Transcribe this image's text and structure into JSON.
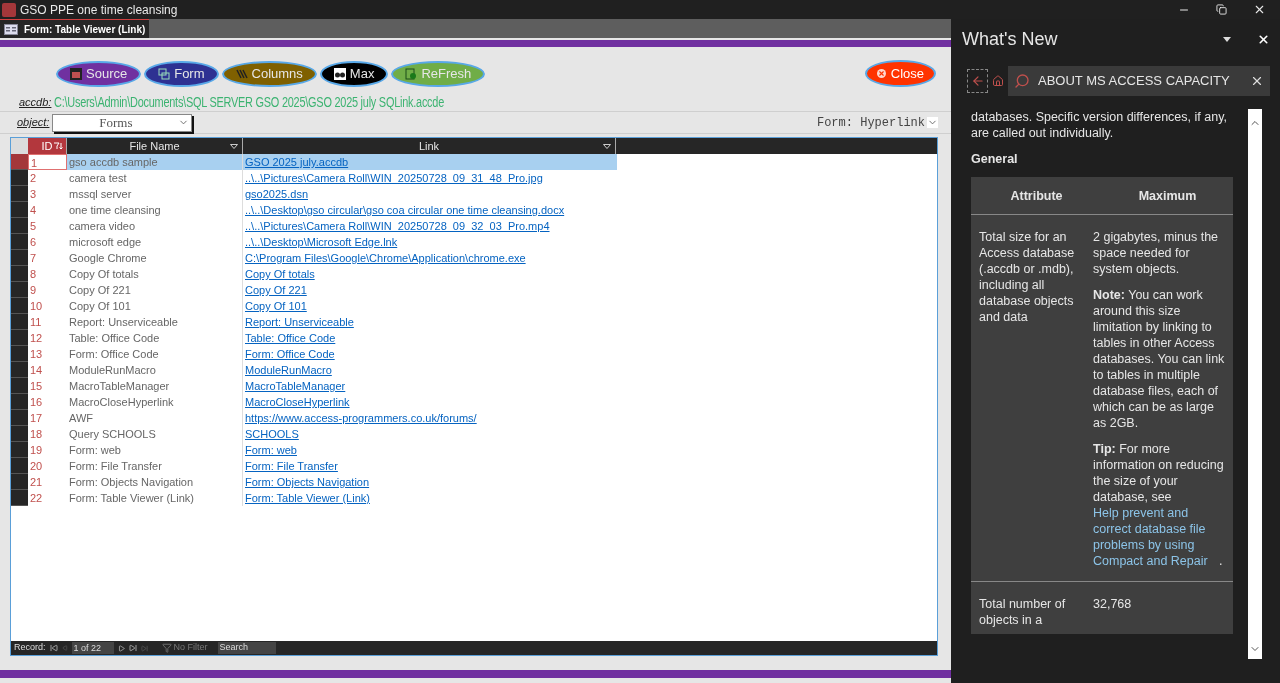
{
  "window": {
    "title": "GSO PPE one time cleansing"
  },
  "document_tabs": [
    {
      "label": "Form: Table Viewer (Link)",
      "selected": true
    }
  ],
  "form": {
    "buttons": [
      {
        "label": "Source",
        "color": "#7030a0"
      },
      {
        "label": "Form",
        "color": "#2e3192"
      },
      {
        "label": "Columns",
        "color": "#7f6000"
      },
      {
        "label": "Max",
        "color": "#000000"
      },
      {
        "label": "ReFresh",
        "color": "#70ad47"
      }
    ],
    "close_button": {
      "label": "Close"
    },
    "accdb": {
      "label": "accdb:",
      "path": "C:\\Users\\Admin\\Documents\\SQL SERVER GSO 2025\\GSO 2025 july SQLink.accde"
    },
    "object": {
      "label": "object:",
      "value": "Forms"
    },
    "form_select": {
      "value": "Form: Hyperlink"
    }
  },
  "datasheet": {
    "columns": [
      {
        "label": "ID",
        "sorted": true
      },
      {
        "label": "File Name",
        "sorted": false
      },
      {
        "label": "Link",
        "sorted": false
      }
    ],
    "rows": [
      {
        "id": "1",
        "name": "gso accdb sample",
        "link": "GSO 2025 july.accdb",
        "selected": true
      },
      {
        "id": "2",
        "name": "camera test",
        "link": "..\\..\\Pictures\\Camera Roll\\WIN_20250728_09_31_48_Pro.jpg",
        "selected": false
      },
      {
        "id": "3",
        "name": "mssql server",
        "link": "gso2025.dsn",
        "selected": false
      },
      {
        "id": "4",
        "name": "one time cleansing",
        "link": "..\\..\\Desktop\\gso circular\\gso coa circular one time cleansing.docx",
        "selected": false
      },
      {
        "id": "5",
        "name": "camera video",
        "link": "..\\..\\Pictures\\Camera Roll\\WIN_20250728_09_32_03_Pro.mp4",
        "selected": false
      },
      {
        "id": "6",
        "name": "microsoft edge",
        "link": "..\\..\\Desktop\\Microsoft Edge.lnk",
        "selected": false
      },
      {
        "id": "7",
        "name": "Google Chrome",
        "link": "C:\\Program Files\\Google\\Chrome\\Application\\chrome.exe",
        "selected": false
      },
      {
        "id": "8",
        "name": "Copy Of totals",
        "link": "Copy Of totals",
        "selected": false
      },
      {
        "id": "9",
        "name": "Copy Of 221",
        "link": "Copy Of 221",
        "selected": false
      },
      {
        "id": "10",
        "name": "Copy Of 101",
        "link": "Copy Of 101",
        "selected": false
      },
      {
        "id": "11",
        "name": "Report: Unserviceable",
        "link": "Report: Unserviceable",
        "selected": false
      },
      {
        "id": "12",
        "name": "Table: Office Code",
        "link": "Table: Office Code",
        "selected": false
      },
      {
        "id": "13",
        "name": "Form: Office Code",
        "link": "Form: Office Code",
        "selected": false
      },
      {
        "id": "14",
        "name": "ModuleRunMacro",
        "link": "ModuleRunMacro",
        "selected": false
      },
      {
        "id": "15",
        "name": "MacroTableManager",
        "link": "MacroTableManager",
        "selected": false
      },
      {
        "id": "16",
        "name": "MacroCloseHyperlink",
        "link": "MacroCloseHyperlink",
        "selected": false
      },
      {
        "id": "17",
        "name": "AWF",
        "link": "https://www.access-programmers.co.uk/forums/",
        "selected": false
      },
      {
        "id": "18",
        "name": "Query SCHOOLS",
        "link": "SCHOOLS",
        "selected": false
      },
      {
        "id": "19",
        "name": "Form: web",
        "link": "Form: web",
        "selected": false
      },
      {
        "id": "20",
        "name": "Form: File Transfer",
        "link": "Form: File Transfer",
        "selected": false
      },
      {
        "id": "21",
        "name": "Form: Objects Navigation",
        "link": "Form: Objects Navigation",
        "selected": false
      },
      {
        "id": "22",
        "name": "Form: Table Viewer (Link)",
        "link": "Form: Table Viewer (Link)",
        "selected": false
      }
    ]
  },
  "navigation": {
    "label": "Record:",
    "position": "1 of 22",
    "filter": "No Filter",
    "search_placeholder": "Search"
  },
  "help_pane": {
    "title": "What's New",
    "search": {
      "value": "ABOUT MS ACCESS CAPACITY"
    },
    "intro": "databases. Specific version differences, if any, are called out individually.",
    "section": "General",
    "table": {
      "columns": [
        "Attribute",
        "Maximum"
      ],
      "rows": [
        {
          "attribute": "Total size for an Access database (.accdb or .mdb), including all database objects and data",
          "maximum": [
            {
              "text": "2 gigabytes, minus the space needed for system objects."
            },
            {
              "text": "**Note:** You can work around this size limitation by linking to tables in other Access databases. You can link to tables in multiple database files, each of which can be as large as 2GB."
            },
            {
              "text": "**Tip:** For more information on reducing the size of your database, see",
              "link": "Help prevent and correct database file problems by using Compact and Repair",
              "after": "."
            }
          ]
        },
        {
          "attribute": "Total number of objects in a",
          "maximum": [
            {
              "text": "32,768"
            }
          ]
        }
      ]
    }
  }
}
